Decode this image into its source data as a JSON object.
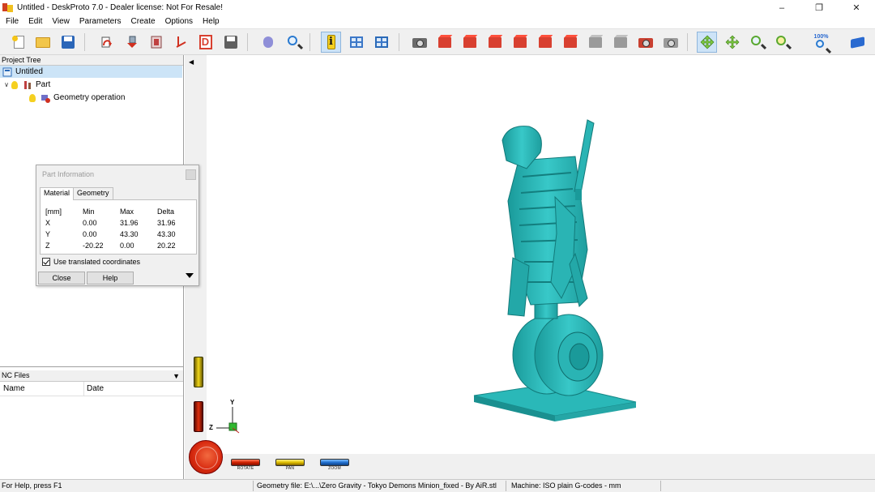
{
  "window": {
    "title": "Untitled - DeskProto 7.0 - Dealer license: Not For Resale!",
    "controls": [
      "minimize",
      "restore",
      "close"
    ]
  },
  "menu": [
    "File",
    "Edit",
    "View",
    "Parameters",
    "Create",
    "Options",
    "Help"
  ],
  "toolbar": {
    "zoom_badge": "100%",
    "icons": [
      "new-file-icon",
      "open-folder-icon",
      "save-icon",
      "part-rotate-icon",
      "part-move-icon",
      "part-scale-icon",
      "part-mirror-icon",
      "dtool-icon",
      "save-nc-icon",
      "operation-icon",
      "preview-icon",
      "info-icon",
      "window-layout-icon",
      "view-settings-icon",
      "camera-icon",
      "view-front-icon",
      "view-back-icon",
      "view-left-icon",
      "view-right-icon",
      "view-top-icon",
      "view-bottom-icon",
      "view-iso1-icon",
      "view-iso2-icon",
      "camera-red-icon",
      "camera-grey-icon",
      "rotate-mode-icon",
      "pan-mode-icon",
      "zoom-mode-icon",
      "zoom-window-icon",
      "zoom-100-icon",
      "help-book-icon"
    ]
  },
  "project_tree": {
    "header": "Project Tree",
    "items": [
      {
        "label": "Untitled",
        "level": 0
      },
      {
        "label": "Part",
        "level": 1
      },
      {
        "label": "Geometry operation",
        "level": 2
      }
    ]
  },
  "nc_files": {
    "header": "NC Files",
    "columns": [
      "Name",
      "Date"
    ]
  },
  "part_info": {
    "title": "Part Information",
    "tabs": [
      "Material",
      "Geometry"
    ],
    "active_tab": "Material",
    "table": {
      "headers": [
        "[mm]",
        "Min",
        "Max",
        "Delta"
      ],
      "rows": [
        [
          "X",
          "0.00",
          "31.96",
          "31.96"
        ],
        [
          "Y",
          "0.00",
          "43.30",
          "43.30"
        ],
        [
          "Z",
          "-20.22",
          "0.00",
          "20.22"
        ]
      ]
    },
    "checkbox_label": "Use translated coordinates",
    "checkbox_checked": true,
    "close_label": "Close",
    "help_label": "Help"
  },
  "viewport": {
    "model_color": "#2fbfbf",
    "controls": {
      "rotate": "ROTATE",
      "pan": "PAN",
      "zoom": "ZOOM"
    },
    "axes": {
      "y": "Y",
      "z": "Z"
    }
  },
  "statusbar": {
    "help": "For Help, press F1",
    "geometry_file": "Geometry file: E:\\...\\Zero Gravity - Tokyo Demons Minion_fixed - By AiR.stl",
    "machine": "Machine: ISO plain G-codes - mm"
  }
}
